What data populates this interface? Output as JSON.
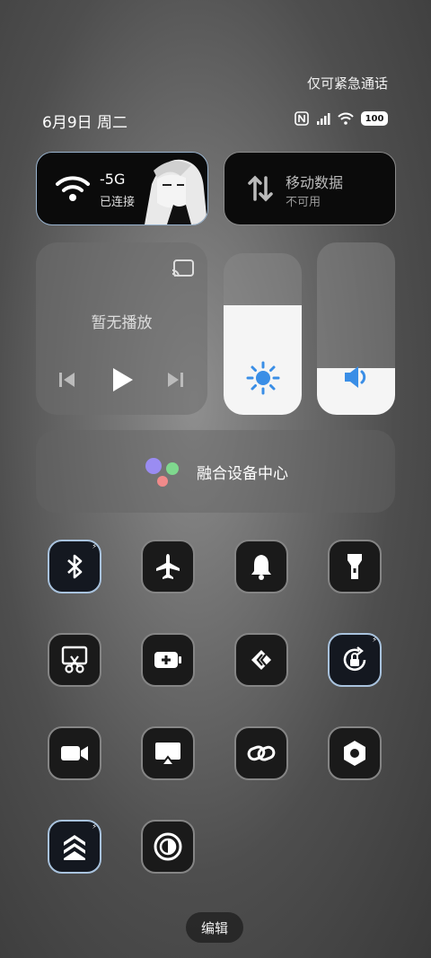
{
  "status_bar": {
    "emergency_text": "仅可紧急通话",
    "date": "6月9日 周二",
    "battery": "100",
    "icons": [
      "nfc-icon",
      "signal-icon",
      "wifi-icon",
      "battery-icon"
    ]
  },
  "wifi_tile": {
    "name": "-5G",
    "status": "已连接",
    "icon": "wifi-icon"
  },
  "data_tile": {
    "name": "移动数据",
    "status": "不可用",
    "icon": "data-transfer-icon"
  },
  "media": {
    "title": "暂无播放",
    "icons": [
      "cast-icon",
      "previous-icon",
      "play-icon",
      "next-icon"
    ]
  },
  "sliders": {
    "brightness_level": 0.68,
    "volume_level": 0.27
  },
  "fusion": {
    "label": "融合设备中心"
  },
  "toggles": [
    {
      "icon": "bluetooth-icon",
      "active": true
    },
    {
      "icon": "airplane-icon",
      "active": false
    },
    {
      "icon": "bell-icon",
      "active": false
    },
    {
      "icon": "flashlight-icon",
      "active": false
    },
    {
      "icon": "screenshot-icon",
      "active": false
    },
    {
      "icon": "battery-saver-icon",
      "active": false
    },
    {
      "icon": "cast-arrows-icon",
      "active": false
    },
    {
      "icon": "rotation-lock-icon",
      "active": true
    },
    {
      "icon": "screen-record-icon",
      "active": false
    },
    {
      "icon": "screen-mirror-icon",
      "active": false
    },
    {
      "icon": "link-icon",
      "active": false
    },
    {
      "icon": "hexagon-nut-icon",
      "active": false
    },
    {
      "icon": "performance-mode-icon",
      "active": true
    },
    {
      "icon": "contrast-icon",
      "active": false
    }
  ],
  "edit_label": "编辑",
  "colors": {
    "active_border": "#a9c3de",
    "tile_bg": "#1a1a1a",
    "slider_fill": "#f5f5f5",
    "slider_icon": "#3a8ee6"
  }
}
